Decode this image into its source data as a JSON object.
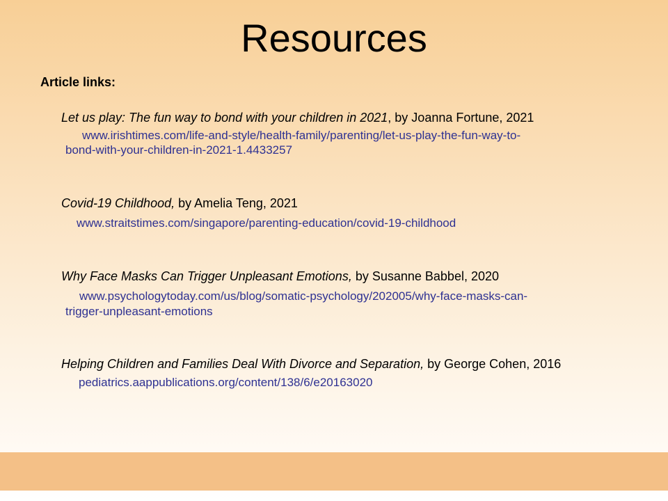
{
  "slide": {
    "title": "Resources",
    "section_label": "Article links:",
    "articles": [
      {
        "title": "Let us play: The fun way to bond with your children in 2021",
        "byline": ", by Joanna Fortune, 2021",
        "link_line1": "www.irishtimes.com/life-and-style/health-family/parenting/let-us-play-the-fun-way-to-",
        "link_line2": "bond-with-your-children-in-2021-1.4433257"
      },
      {
        "title": "Covid-19 Childhood,",
        "byline": " by Amelia Teng, 2021",
        "link_line1": "www.straitstimes.com/singapore/parenting-education/covid-19-childhood"
      },
      {
        "title": "Why Face Masks Can Trigger Unpleasant Emotions,",
        "byline": " by Susanne Babbel, 2020",
        "link_line1": "www.psychologytoday.com/us/blog/somatic-psychology/202005/why-face-masks-can-",
        "link_line2": "trigger-unpleasant-emotions"
      },
      {
        "title": "Helping Children and Families Deal With Divorce and Separation,",
        "byline": " by George Cohen, 2016",
        "link_line1": "pediatrics.aappublications.org/content/138/6/e20163020"
      }
    ]
  },
  "colors": {
    "link": "#2e3192",
    "footer_band": "#f4c087",
    "background_top": "#f8cf96"
  }
}
